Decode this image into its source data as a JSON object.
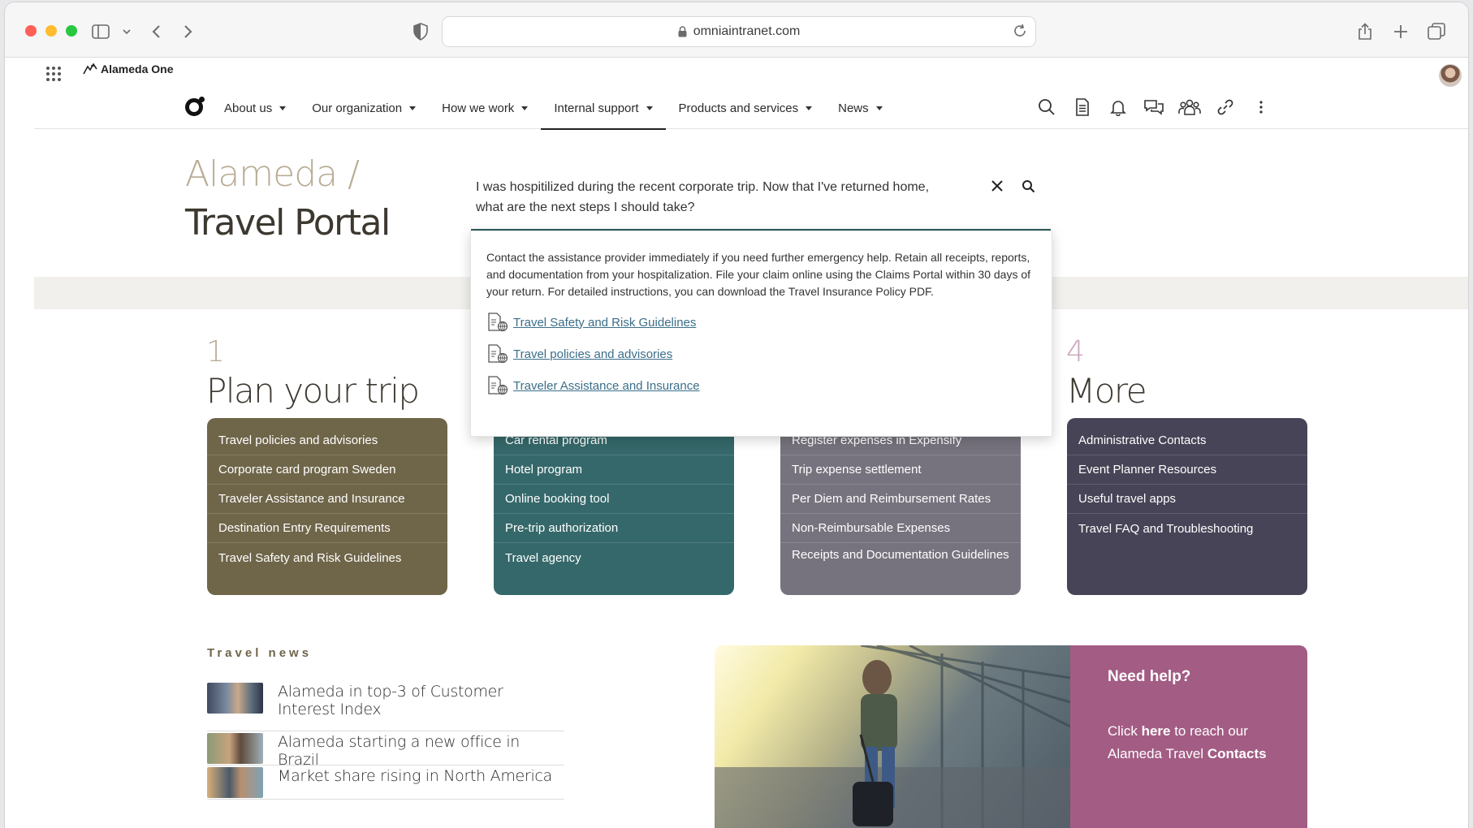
{
  "browser": {
    "url": "omniaintranet.com"
  },
  "app": {
    "brand": "Alameda One"
  },
  "nav": {
    "items": [
      {
        "label": "About us"
      },
      {
        "label": "Our organization"
      },
      {
        "label": "How we work"
      },
      {
        "label": "Internal support",
        "active": true
      },
      {
        "label": "Products and services"
      },
      {
        "label": "News"
      }
    ]
  },
  "page": {
    "crumb": "Alameda /",
    "title": "Travel Portal"
  },
  "search": {
    "query_line1": "I was hospitilized during the recent corporate trip. Now that I've returned home,",
    "query_line2": "what are the next steps I should take?",
    "answer": "Contact the assistance provider immediately if you need further emergency help. Retain all receipts, reports, and documentation from your hospitalization. File your claim online using the Claims Portal within 30 days of your return. For detailed instructions, you can download the Travel Insurance Policy PDF.",
    "links": [
      "Travel Safety and Risk Guidelines",
      "Travel policies and advisories",
      "Traveler Assistance and Insurance"
    ]
  },
  "steps": [
    {
      "number": "1",
      "title": "Plan your trip",
      "color": "#6f6549",
      "items": [
        "Travel policies and advisories",
        "Corporate card program Sweden",
        "Traveler Assistance and Insurance",
        "Destination Entry Requirements",
        "Travel Safety and Risk Guidelines"
      ]
    },
    {
      "color": "#35686a",
      "items": [
        "Car rental program",
        "Hotel program",
        "Online booking tool",
        "Pre-trip authorization",
        "Travel agency"
      ]
    },
    {
      "color": "#77737e",
      "items": [
        "Register expenses in Expensify",
        "Trip expense settlement",
        "Per Diem and Reimbursement Rates",
        "Non-Reimbursable Expenses",
        "Receipts and Documentation Guidelines"
      ]
    },
    {
      "number": "4",
      "title": "More",
      "color": "#464456",
      "items": [
        "Administrative Contacts",
        "Event Planner Resources",
        "Useful travel apps",
        "Travel FAQ and Troubleshooting"
      ]
    }
  ],
  "news": {
    "label": "Travel news",
    "items": [
      "Alameda in top-3 of Customer Interest Index",
      "Alameda starting a new office in Brazil",
      "Market share rising in North America"
    ]
  },
  "help": {
    "title": "Need help?",
    "text_pre": "Click ",
    "text_here": "here",
    "text_mid": " to reach our",
    "text_line2": "Alameda Travel ",
    "text_contacts": "Contacts"
  }
}
